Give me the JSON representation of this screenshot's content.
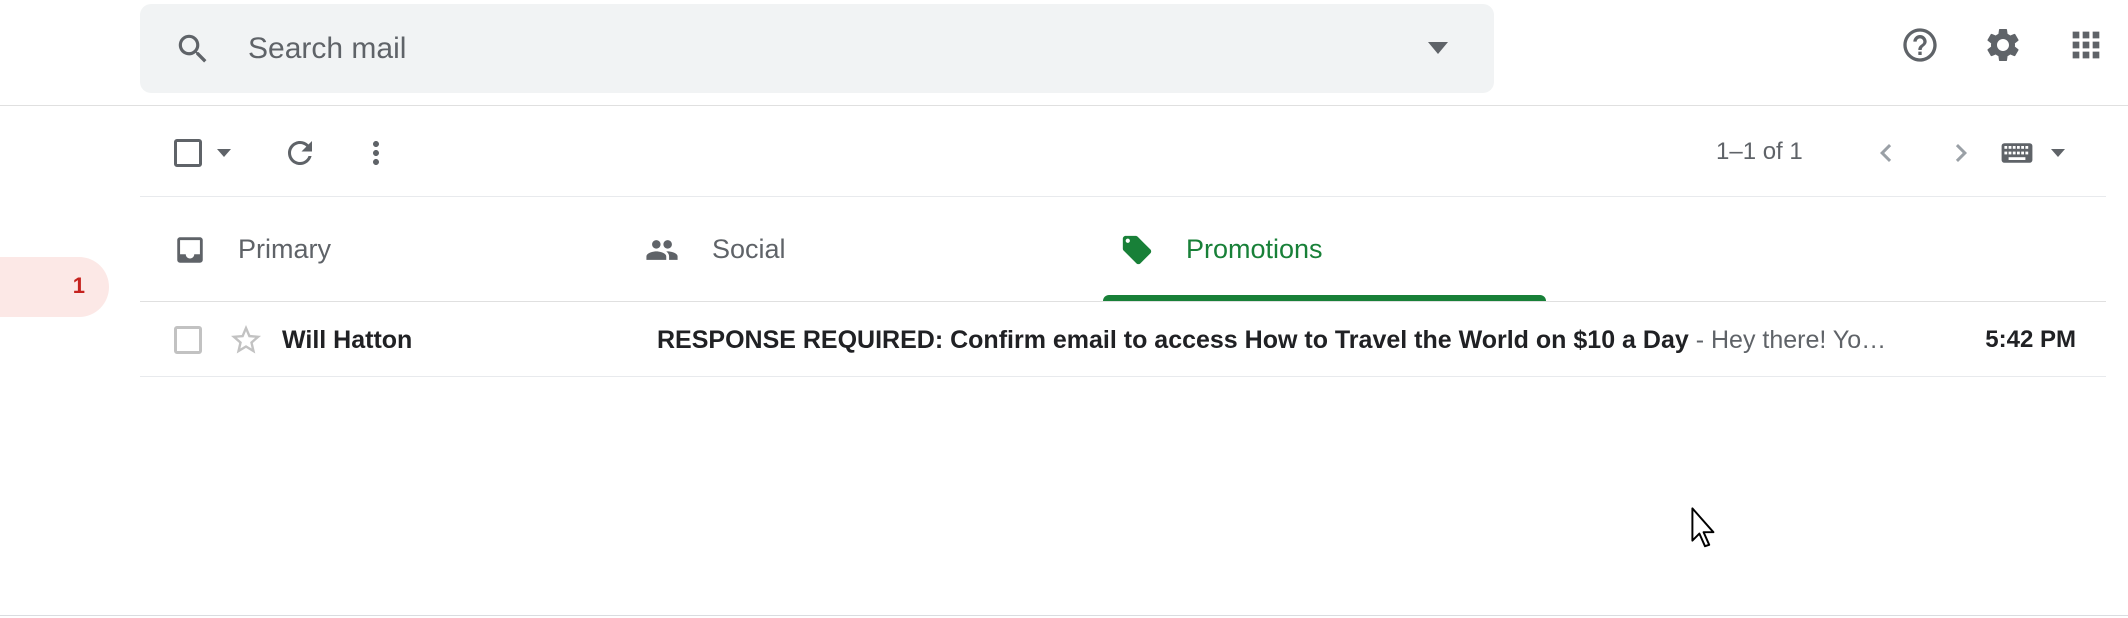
{
  "search": {
    "placeholder": "Search mail",
    "value": ""
  },
  "header_icons": [
    "help-icon",
    "settings-icon",
    "apps-icon"
  ],
  "toolbar": {
    "pagination": "1–1 of 1",
    "icons": [
      "select-checkbox",
      "select-dropdown-icon",
      "refresh-icon",
      "more-icon",
      "newer-icon",
      "older-icon",
      "keyboard-icon",
      "input-tools-dropdown-icon"
    ]
  },
  "rail": {
    "badge_count": "1"
  },
  "tabs": [
    {
      "label": "Primary",
      "icon": "inbox-icon",
      "active": false
    },
    {
      "label": "Social",
      "icon": "people-icon",
      "active": false
    },
    {
      "label": "Promotions",
      "icon": "tag-icon",
      "active": true
    }
  ],
  "emails": [
    {
      "sender": "Will Hatton",
      "subject": "RESPONSE REQUIRED: Confirm email to access How to Travel the World on $10 a Day",
      "separator": " - ",
      "snippet": "Hey there! Yo…",
      "time": "5:42 PM",
      "starred": false,
      "selected": false
    }
  ],
  "colors": {
    "accent_green": "#188038",
    "badge_bg": "#fce8e6",
    "badge_text": "#c5221f",
    "search_bg": "#f1f3f4",
    "icon_gray": "#5f6368"
  }
}
